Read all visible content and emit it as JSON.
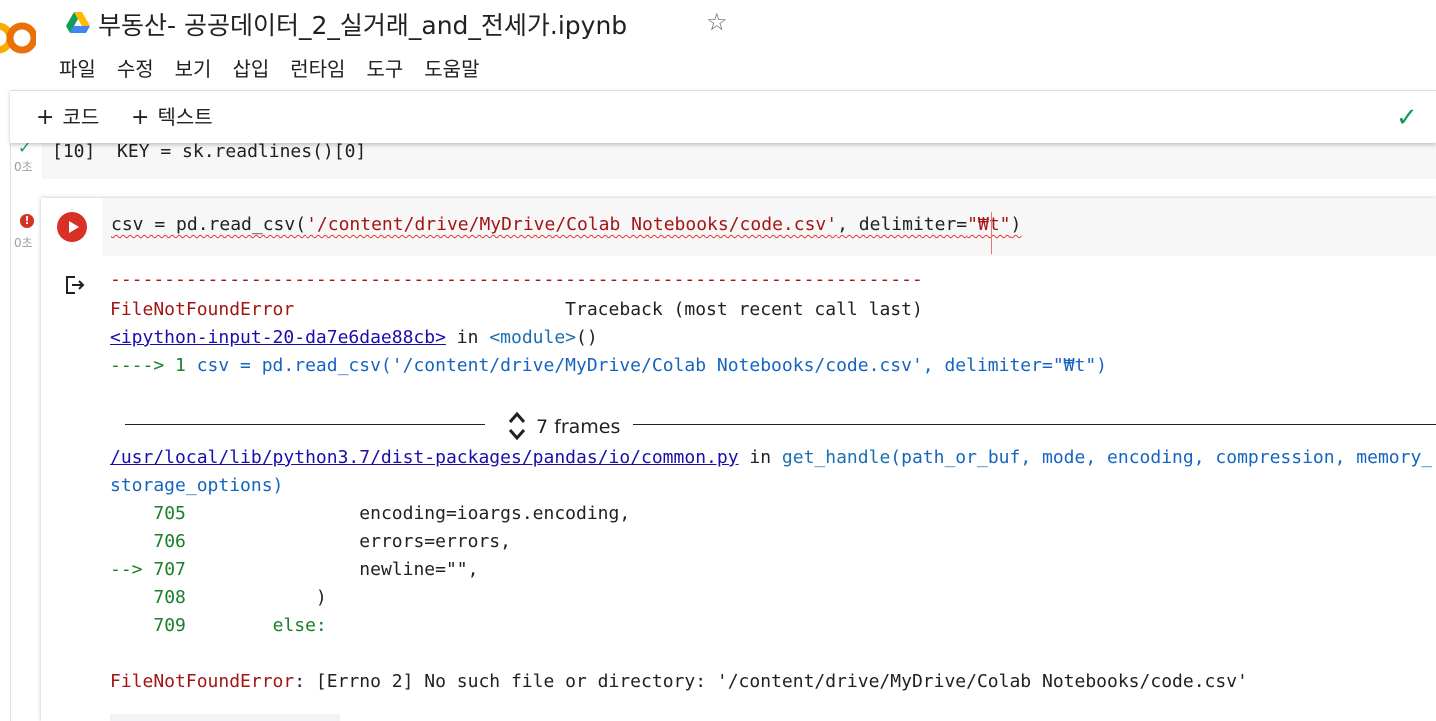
{
  "header": {
    "title": "부동산- 공공데이터_2_실거래_and_전세가.ipynb",
    "menu": [
      "파일",
      "수정",
      "보기",
      "삽입",
      "런타임",
      "도구",
      "도움말"
    ]
  },
  "toolbar": {
    "add_code": "코드",
    "add_text": "텍스트"
  },
  "cells": [
    {
      "status": "success",
      "time": "0초",
      "code": "[10]  KEY = sk.readlines()[0]"
    },
    {
      "status": "error",
      "error_mark": "!",
      "time": "0초",
      "code_prefix": "csv = pd.read_csv(",
      "code_path": "'/content/drive/MyDrive/Colab Notebooks/code.csv'",
      "code_mid": ", delimiter=",
      "code_delim": "\"₩t\"",
      "code_suffix": ")"
    }
  ],
  "output": {
    "dashes": "---------------------------------------------------------------------------",
    "error_name": "FileNotFoundError",
    "traceback_header": "Traceback (most recent call last)",
    "input_link": "<ipython-input-20-da7e6dae88cb>",
    "in_word": " in ",
    "module": "<module>",
    "module_parens": "()",
    "arrow_line_prefix": "----> 1 ",
    "arrow_line_code": "csv = pd.read_csv('/content/drive/MyDrive/Colab Notebooks/code.csv', delimiter=\"₩t\")",
    "frames_label": "7 frames",
    "file_link": "/usr/local/lib/python3.7/dist-packages/pandas/io/common.py",
    "in_word2": " in ",
    "func_name": "get_handle",
    "func_args": "(path_or_buf, mode, encoding, compression, memory_",
    "func_args_cont": "storage_options)",
    "source_lines": [
      {
        "marker": "    ",
        "num": "705",
        "code": "                encoding=ioargs.encoding,"
      },
      {
        "marker": "    ",
        "num": "706",
        "code": "                errors=errors,"
      },
      {
        "marker": "--> ",
        "num": "707",
        "code": "                newline=\"\","
      },
      {
        "marker": "    ",
        "num": "708",
        "code": "            )"
      },
      {
        "marker": "    ",
        "num": "709",
        "code": "        else:"
      }
    ],
    "final_error_name": "FileNotFoundError",
    "final_error_msg": ": [Errno 2] No such file or directory: '/content/drive/MyDrive/Colab Notebooks/code.csv'"
  },
  "colors": {
    "error_red": "#d93025",
    "success_green": "#0f9d58",
    "traceback_red": "#a31515",
    "link_blue": "#1a0dab"
  },
  "icons": {
    "logo": "colab-logo-icon",
    "drive": "google-drive-icon",
    "star": "star-icon",
    "check": "check-icon",
    "run": "run-button-icon",
    "output": "output-clear-icon",
    "frames": "expand-collapse-icon"
  }
}
